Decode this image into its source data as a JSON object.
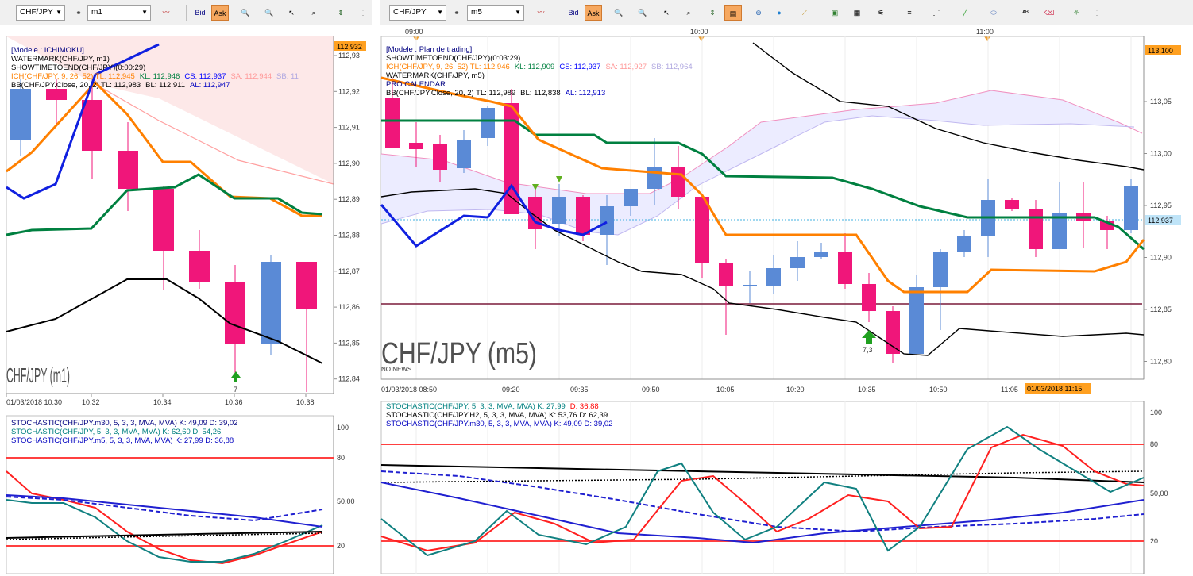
{
  "left_toolbar": {
    "symbol": "CHF/JPY",
    "timeframe": "m1",
    "bid_label": "Bid",
    "ask_label": "Ask"
  },
  "right_toolbar": {
    "symbol": "CHF/JPY",
    "timeframe": "m5",
    "bid_label": "Bid",
    "ask_label": "Ask"
  },
  "left_chart": {
    "legend": [
      {
        "text": "[Modele : ICHIMOKU]",
        "color": "#000080"
      },
      {
        "text": "WATERMARK(CHF/JPY, m1)",
        "color": "#000000"
      },
      {
        "text": "SHOWTIMETOEND(CHF/JPY)(0:00:29)",
        "color": "#000000"
      }
    ],
    "ich_line": [
      {
        "text": "ICH(CHF/JPY, 9, 26, 52)  TL: 112,945",
        "color": "#ff8000"
      },
      {
        "text": "KL: 112,946",
        "color": "#008040"
      },
      {
        "text": "CS: 112,937",
        "color": "#0000ff"
      },
      {
        "text": "SA: 112,944",
        "color": "#ff9999"
      },
      {
        "text": "SB: 11",
        "color": "#b0a8e0"
      }
    ],
    "bb_line": [
      {
        "text": "BB(CHF/JPY.Close, 20, 2)  TL: 112,983",
        "color": "#000000"
      },
      {
        "text": "BL: 112,911",
        "color": "#000000"
      },
      {
        "text": "AL: 112,947",
        "color": "#0000c0"
      }
    ],
    "watermark": "CHF/JPY (m1)",
    "price_tag": "112,932",
    "price_labels": [
      "112,93",
      "112,92",
      "112,91",
      "112,90",
      "112,89",
      "112,88",
      "112,87",
      "112,86",
      "112,85",
      "112,84"
    ],
    "time_labels": [
      "01/03/2018 10:30",
      "10:32",
      "10:34",
      "10:36",
      "10:38"
    ],
    "arrow_label": "7"
  },
  "right_chart": {
    "legend": [
      {
        "text": "[Modele : Plan de trading]",
        "color": "#000080"
      },
      {
        "text": "SHOWTIMETOEND(CHF/JPY)(0:03:29)",
        "color": "#000000"
      }
    ],
    "ich_line": [
      {
        "text": "ICH(CHF/JPY, 9, 26, 52)  TL: 112,946",
        "color": "#ff8000"
      },
      {
        "text": "KL: 112,909",
        "color": "#008040"
      },
      {
        "text": "CS: 112,937",
        "color": "#0000ff"
      },
      {
        "text": "SA: 112,927",
        "color": "#ff9999"
      },
      {
        "text": "SB: 112,964",
        "color": "#b0a8e0"
      }
    ],
    "legend2": [
      {
        "text": "WATERMARK(CHF/JPY, m5)",
        "color": "#000000"
      },
      {
        "text": "PRO CALENDAR",
        "color": "#000080"
      }
    ],
    "bb_line": [
      {
        "text": "BB(CHF/JPY.Close, 20, 2)  TL: 112,989",
        "color": "#000000"
      },
      {
        "text": "BL: 112,838",
        "color": "#000000"
      },
      {
        "text": "AL: 112,913",
        "color": "#0000c0"
      }
    ],
    "watermark": "CHF/JPY (m5)",
    "no_news": "NO NEWS",
    "price_tag_top": "113,100",
    "price_tag_current": "112,937",
    "price_labels": [
      "113,05",
      "113,00",
      "112,95",
      "112,90",
      "112,85",
      "112,80"
    ],
    "top_time_labels": [
      "09:00",
      "10:00",
      "11:00"
    ],
    "time_labels": [
      "01/03/2018 08:50",
      "09:20",
      "09:35",
      "09:50",
      "10:05",
      "10:20",
      "10:35",
      "10:50",
      "11:05"
    ],
    "time_tag": "01/03/2018 11:15",
    "arrow_label": "7,3"
  },
  "left_stoch": {
    "legend": [
      {
        "text": "STOCHASTIC(CHF/JPY.m30, 5, 3, 3, MVA, MVA)  K: 49,09  D: 39,02",
        "color": "#000080"
      },
      {
        "text": "STOCHASTIC(CHF/JPY, 5, 3, 3, MVA, MVA)  K: 62,60  D: 54,26",
        "color": "#008080"
      },
      {
        "text": "STOCHASTIC(CHF/JPY.m5, 5, 3, 3, MVA, MVA)  K: 27,99  D: 36,88",
        "color": "#0000c0"
      }
    ],
    "levels": [
      "100",
      "80",
      "50,00",
      "20"
    ]
  },
  "right_stoch": {
    "legend": [
      [
        {
          "text": "STOCHASTIC(CHF/JPY, 5, 3, 3, MVA, MVA)  K: 27,99",
          "color": "#008080"
        },
        {
          "text": "D: 36,88",
          "color": "#ff0000"
        }
      ],
      [
        {
          "text": "STOCHASTIC(CHF/JPY.H2, 5, 3, 3, MVA, MVA)  K: 53,76  D: 62,39",
          "color": "#000000"
        }
      ],
      [
        {
          "text": "STOCHASTIC(CHF/JPY.m30, 5, 3, 3, MVA, MVA)  K: 49,09  D: 39,02",
          "color": "#0000c0"
        }
      ]
    ],
    "levels": [
      "100",
      "80",
      "50,00",
      "20"
    ]
  },
  "colors": {
    "bull": "#5a8ad6",
    "bear": "#f0167a",
    "tenkan": "#ff8000",
    "kijun": "#008040",
    "chikou": "#1020e0",
    "bollinger": "#000000",
    "price_tag": "#ffa020",
    "current_tag": "#bfe4f8",
    "level_line": "#ff4040",
    "support_line": "#7a1a3a"
  }
}
